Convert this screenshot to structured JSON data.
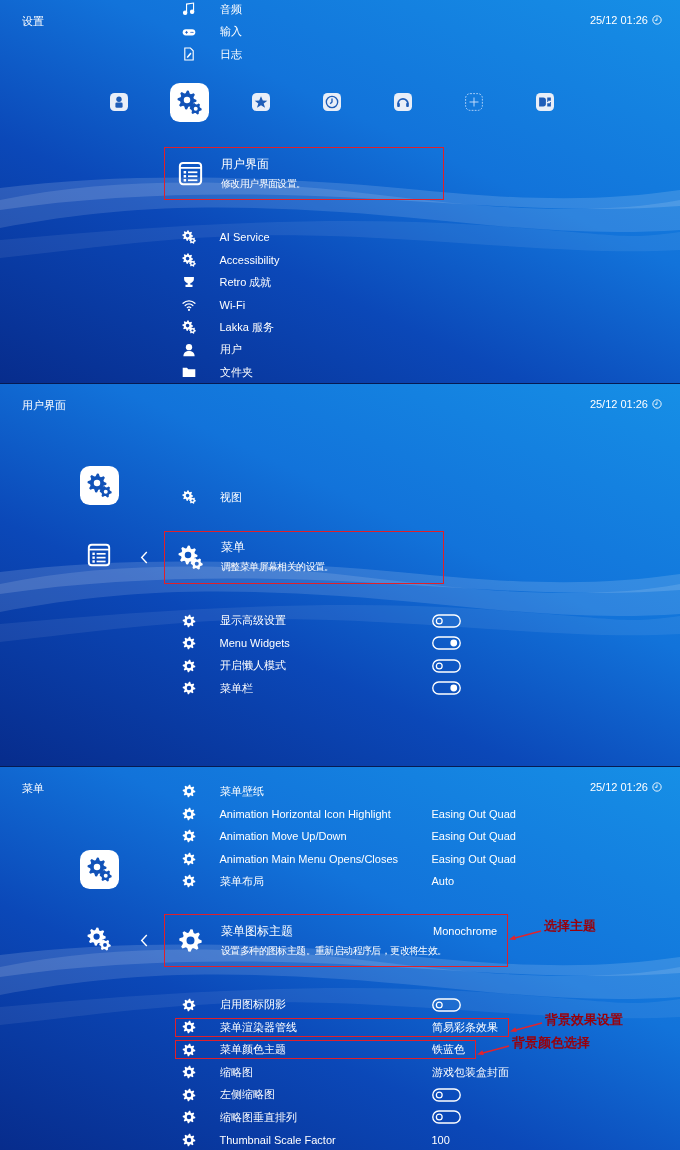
{
  "panels": [
    {
      "kind": "main",
      "title": "设置",
      "clock": "25/12 01:26",
      "top_items": [
        {
          "kind": "link",
          "label": "音频"
        },
        {
          "kind": "link",
          "label": "输入"
        },
        {
          "kind": "link",
          "label": "日志"
        }
      ],
      "categories": [
        {
          "selected": false
        },
        {
          "selected": true
        },
        {
          "selected": false
        },
        {
          "selected": false
        },
        {
          "selected": false
        },
        {
          "selected": false
        },
        {
          "selected": false
        }
      ],
      "current": {
        "label": "用户界面",
        "description": "修改用户界面设置。",
        "boxed": true
      },
      "items": [
        {
          "kind": "link",
          "label": "AI Service"
        },
        {
          "kind": "link",
          "label": "Accessibility"
        },
        {
          "kind": "link",
          "label": "Retro 成就"
        },
        {
          "kind": "link",
          "label": "Wi-Fi"
        },
        {
          "kind": "link",
          "label": "Lakka 服务"
        },
        {
          "kind": "link",
          "label": "用户"
        },
        {
          "kind": "link",
          "label": "文件夹"
        }
      ]
    },
    {
      "kind": "sub",
      "title": "用户界面",
      "clock": "25/12 01:26",
      "top_items": [
        {
          "kind": "link",
          "label": "视图"
        }
      ],
      "current": {
        "label": "菜单",
        "description": "调整菜单屏幕相关的设置。",
        "boxed": true
      },
      "items": [
        {
          "kind": "toggle",
          "label": "显示高级设置",
          "on": false
        },
        {
          "kind": "toggle",
          "label": "Menu Widgets",
          "on": true
        },
        {
          "kind": "toggle",
          "label": "开启懒人模式",
          "on": false
        },
        {
          "kind": "toggle",
          "label": "菜单栏",
          "on": true
        }
      ]
    },
    {
      "kind": "sub",
      "title": "菜单",
      "clock": "25/12 01:26",
      "top_items": [
        {
          "kind": "link",
          "label": "菜单壁纸"
        },
        {
          "kind": "value",
          "label": "Animation Horizontal Icon Highlight",
          "value": "Easing Out Quad"
        },
        {
          "kind": "value",
          "label": "Animation Move Up/Down",
          "value": "Easing Out Quad"
        },
        {
          "kind": "value",
          "label": "Animation Main Menu Opens/Closes",
          "value": "Easing Out Quad"
        },
        {
          "kind": "value",
          "label": "菜单布局",
          "value": "Auto"
        }
      ],
      "current": {
        "label": "菜单图标主题",
        "description": "设置多种的图标主题。重新启动程序后，更改将生效。",
        "value": "Monochrome",
        "boxed": true,
        "note": "选择主题"
      },
      "items": [
        {
          "kind": "toggle",
          "label": "启用图标阴影",
          "on": false,
          "boxed": false
        },
        {
          "kind": "value",
          "label": "菜单渲染器管线",
          "value": "简易彩条效果",
          "boxed": true,
          "note": "背景效果设置"
        },
        {
          "kind": "value",
          "label": "菜单颜色主题",
          "value": "铁蓝色",
          "boxed": true,
          "note": "背景颜色选择"
        },
        {
          "kind": "value",
          "label": "缩略图",
          "value": "游戏包装盒封面",
          "boxed": false
        },
        {
          "kind": "toggle",
          "label": "左侧缩略图",
          "on": false,
          "boxed": false
        },
        {
          "kind": "toggle",
          "label": "缩略图垂直排列",
          "on": false,
          "boxed": false
        },
        {
          "kind": "value",
          "label": "Thumbnail Scale Factor",
          "value": "100",
          "boxed": false
        }
      ]
    }
  ]
}
